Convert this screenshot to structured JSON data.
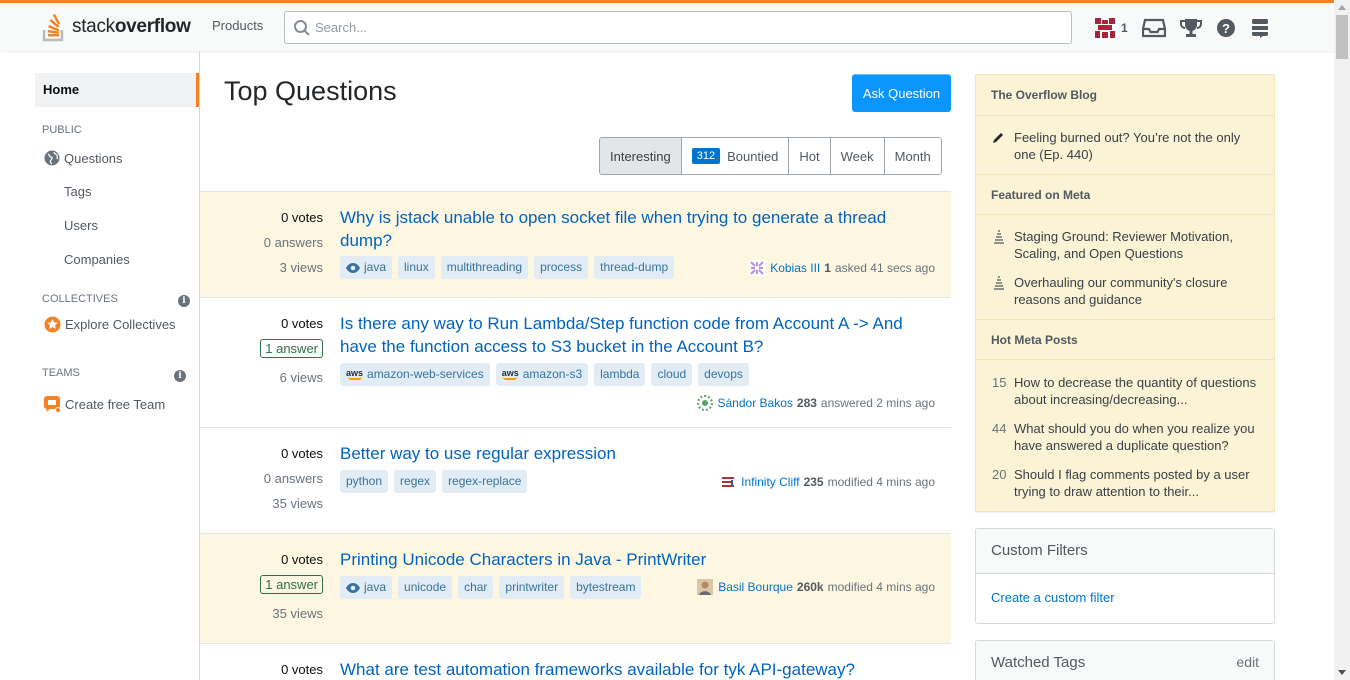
{
  "header": {
    "logo_prefix": "stack",
    "logo_suffix": "overflow",
    "products": "Products",
    "search_placeholder": "Search...",
    "reputation": "1"
  },
  "sidebar": {
    "home": "Home",
    "public": "PUBLIC",
    "questions": "Questions",
    "tags": "Tags",
    "users": "Users",
    "companies": "Companies",
    "collectives": "COLLECTIVES",
    "explore_collectives": "Explore Collectives",
    "teams": "TEAMS",
    "create_team": "Create free Team",
    "info": "i"
  },
  "main": {
    "title": "Top Questions",
    "ask_button": "Ask Question",
    "tabs": [
      {
        "label": "Interesting"
      },
      {
        "label": "Bountied",
        "badge": "312"
      },
      {
        "label": "Hot"
      },
      {
        "label": "Week"
      },
      {
        "label": "Month"
      }
    ],
    "questions": [
      {
        "votes": "0 votes",
        "answers": "0 answers",
        "views": "3 views",
        "title": "Why is jstack unable to open socket file when trying to generate a thread dump?",
        "tags": [
          "java",
          "linux",
          "multithreading",
          "process",
          "thread-dump"
        ],
        "user": "Kobias III",
        "rep": "1",
        "action": "asked 41 secs ago"
      },
      {
        "votes": "0 votes",
        "answers": "1 answer",
        "views": "6 views",
        "title": "Is there any way to Run Lambda/Step function code from Account A -> And have the function access to S3 bucket in the Account B?",
        "tags": [
          "amazon-web-services",
          "amazon-s3",
          "lambda",
          "cloud",
          "devops"
        ],
        "user": "Sándor Bakos",
        "rep": "283",
        "action": "answered 2 mins ago"
      },
      {
        "votes": "0 votes",
        "answers": "0 answers",
        "views": "35 views",
        "title": "Better way to use regular expression",
        "tags": [
          "python",
          "regex",
          "regex-replace"
        ],
        "user": "Infinity Cliff",
        "rep": "235",
        "action": "modified 4 mins ago"
      },
      {
        "votes": "0 votes",
        "answers": "1 answer",
        "views": "35 views",
        "title": "Printing Unicode Characters in Java - PrintWriter",
        "tags": [
          "java",
          "unicode",
          "char",
          "printwriter",
          "bytestream"
        ],
        "user": "Basil Bourque",
        "rep": "260k",
        "action": "modified 4 mins ago"
      },
      {
        "votes": "0 votes",
        "title": "What are test automation frameworks available for tyk API-gateway?"
      }
    ]
  },
  "right": {
    "blog_title": "The Overflow Blog",
    "blog_post": "Feeling burned out? You’re not the only one (Ep. 440)",
    "meta_title": "Featured on Meta",
    "meta_posts": [
      "Staging Ground: Reviewer Motivation, Scaling, and Open Questions",
      "Overhauling our community's closure reasons and guidance"
    ],
    "hot_title": "Hot Meta Posts",
    "hot_posts": [
      {
        "count": "15",
        "text": "How to decrease the quantity of questions about increasing/decreasing..."
      },
      {
        "count": "44",
        "text": "What should you do when you realize you have answered a duplicate question?"
      },
      {
        "count": "20",
        "text": "Should I flag comments posted by a user trying to draw attention to their..."
      }
    ],
    "custom_filters": "Custom Filters",
    "create_filter": "Create a custom filter",
    "watched_tags": "Watched Tags",
    "edit": "edit"
  },
  "colors": {
    "accent": "#f48225",
    "link": "#0063bf",
    "primary_button": "#0a95ff",
    "highlight_row": "#fdf7e2",
    "tag_bg": "#e1ecf4",
    "tag_text": "#39739d",
    "answered": "#2f6f44"
  },
  "icons": [
    "stackoverflow-logo-icon",
    "search-icon",
    "inbox-icon",
    "trophy-icon",
    "help-icon",
    "stackexchange-icon",
    "globe-icon",
    "collectives-icon",
    "teams-icon",
    "info-icon",
    "pencil-icon",
    "meta-icon",
    "eye-icon",
    "aws-icon"
  ]
}
